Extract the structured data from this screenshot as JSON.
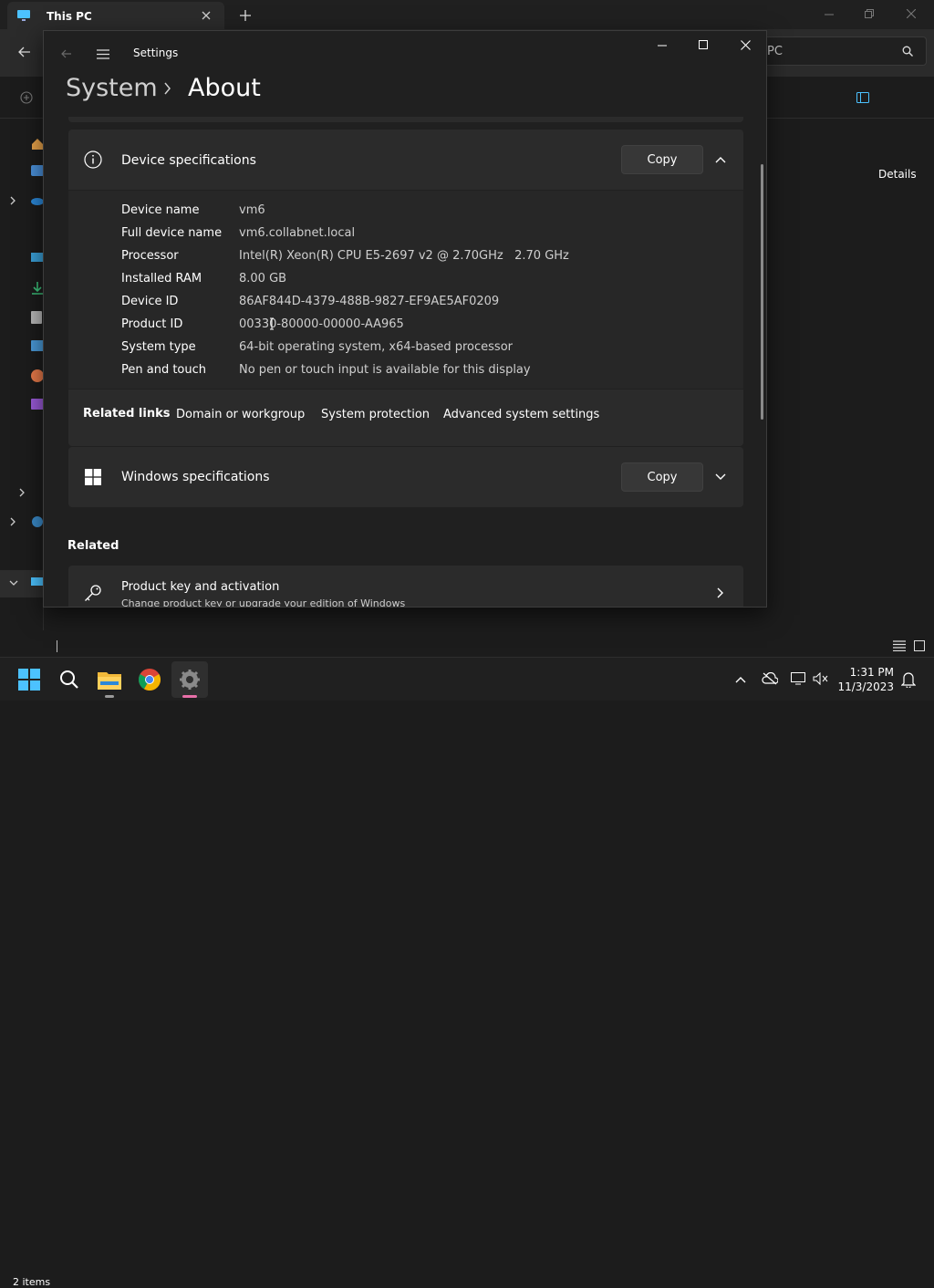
{
  "explorer": {
    "tab_title": "This PC",
    "search_text": "PC",
    "details_label": "Details",
    "status_items": "2 items"
  },
  "settings": {
    "window_title": "Settings",
    "breadcrumb": {
      "parent": "System",
      "current": "About"
    },
    "device_specs": {
      "title": "Device specifications",
      "copy_label": "Copy",
      "rows": [
        {
          "label": "Device name",
          "value": "vm6"
        },
        {
          "label": "Full device name",
          "value": "vm6.collabnet.local"
        },
        {
          "label": "Processor",
          "value": "Intel(R) Xeon(R) CPU E5-2697 v2 @ 2.70GHz   2.70 GHz"
        },
        {
          "label": "Installed RAM",
          "value": "8.00 GB"
        },
        {
          "label": "Device ID",
          "value": "86AF844D-4379-488B-9827-EF9AE5AF0209"
        },
        {
          "label": "Product ID",
          "value": "00330-80000-00000-AA965"
        },
        {
          "label": "System type",
          "value": "64-bit operating system, x64-based processor"
        },
        {
          "label": "Pen and touch",
          "value": "No pen or touch input is available for this display"
        }
      ]
    },
    "related_links": {
      "label": "Related links",
      "links": [
        "Domain or workgroup",
        "System protection",
        "Advanced system settings"
      ]
    },
    "windows_specs": {
      "title": "Windows specifications",
      "copy_label": "Copy"
    },
    "related_header": "Related",
    "product_key": {
      "title": "Product key and activation",
      "subtitle": "Change product key or upgrade your edition of Windows"
    }
  },
  "taskbar": {
    "time": "1:31 PM",
    "date": "11/3/2023",
    "apps": [
      "start-icon",
      "search-icon",
      "file-explorer-icon",
      "chrome-icon",
      "settings-icon"
    ]
  },
  "colors": {
    "background": "#202020",
    "card": "#2b2b2b",
    "accent": "#4cc2ff"
  }
}
